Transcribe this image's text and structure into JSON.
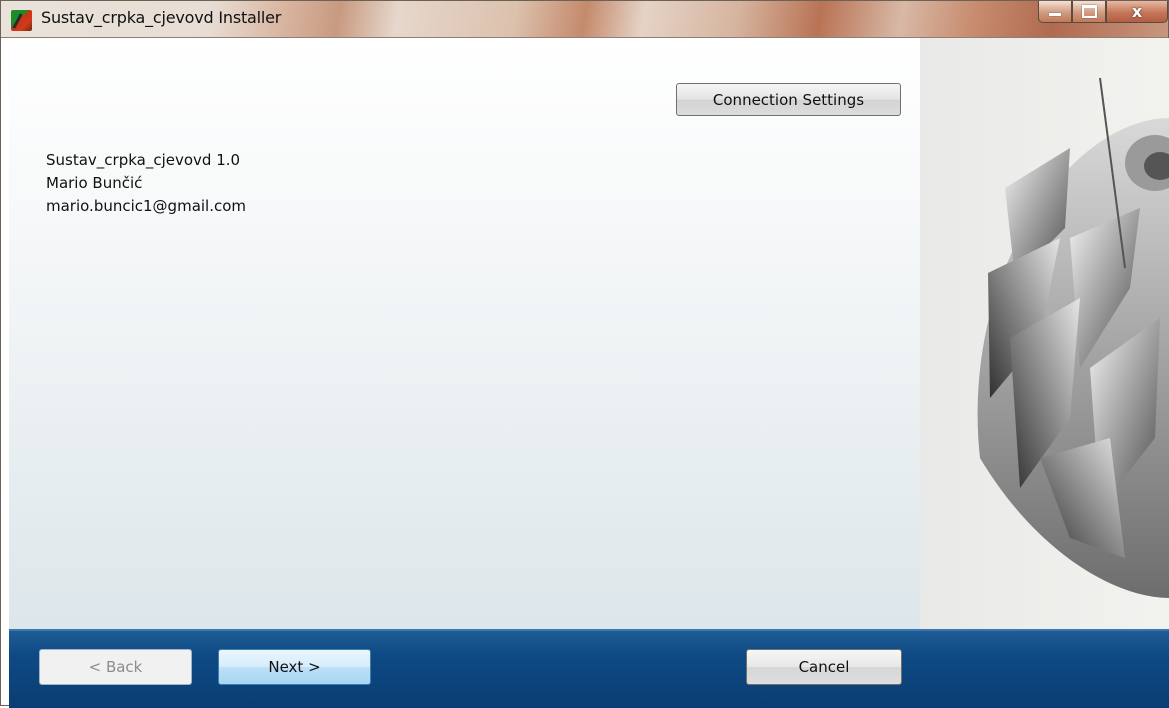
{
  "window": {
    "title": "Sustav_crpka_cjevovd Installer",
    "controls": {
      "minimize_icon": "minimize-icon",
      "maximize_icon": "maximize-icon",
      "close_label": "x"
    }
  },
  "main": {
    "connection_settings_label": "Connection Settings",
    "info": {
      "product": "Sustav_crpka_cjevovd 1.0",
      "author": "Mario Bunčić",
      "email": "mario.buncic1@gmail.com"
    },
    "side_image": "impeller-image"
  },
  "footer": {
    "back_label": "< Back",
    "next_label": "Next >",
    "cancel_label": "Cancel"
  },
  "colors": {
    "footer_blue": "#0f4a85",
    "next_button": "#bde0f7"
  }
}
